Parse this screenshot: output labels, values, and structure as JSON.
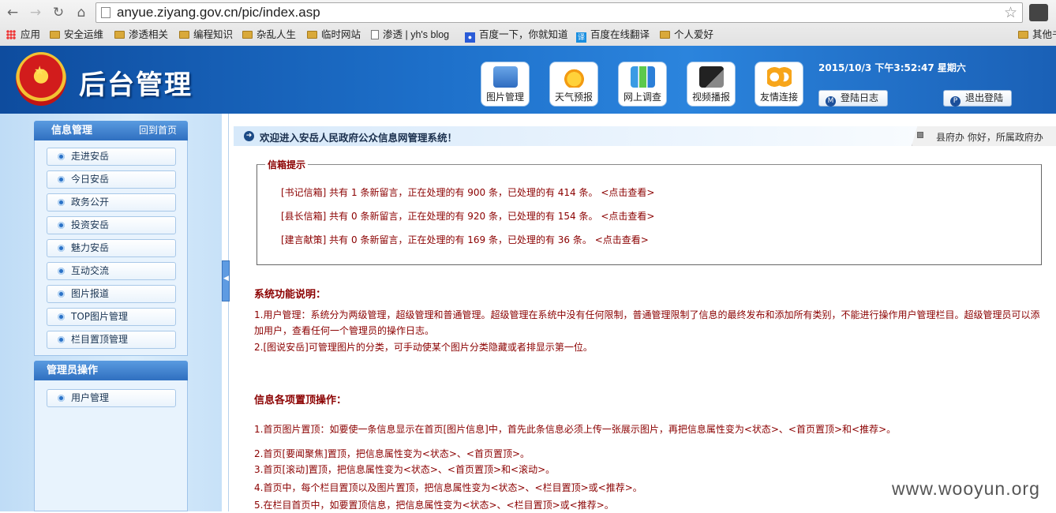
{
  "browser": {
    "url": "anyue.ziyang.gov.cn/pic/index.asp",
    "bookmarks": [
      "应用",
      "安全运维",
      "渗透相关",
      "编程知识",
      "杂乱人生",
      "临时网站",
      "渗透 | yh's blog",
      "百度一下，你就知道",
      "百度在线翻译",
      "个人爱好",
      "其他书签"
    ]
  },
  "header": {
    "title": "后台管理",
    "tools": [
      "图片管理",
      "天气预报",
      "网上调查",
      "视频播报",
      "友情连接"
    ],
    "datetime": "2015/10/3 下午3:52:47 星期六",
    "login_log": "登陆日志",
    "logout": "退出登陆"
  },
  "sidebar": {
    "section1": {
      "title": "信息管理",
      "link": "回到首页"
    },
    "items": [
      "走进安岳",
      "今日安岳",
      "政务公开",
      "投资安岳",
      "魅力安岳",
      "互动交流",
      "图片报道",
      "TOP图片管理",
      "栏目置顶管理"
    ],
    "section2": {
      "title": "管理员操作"
    },
    "admin_items": [
      "用户管理"
    ]
  },
  "main": {
    "welcome": "欢迎进入安岳人民政府公众信息网管理系统！",
    "user_info": "县府办 你好，所属政府办",
    "mailbox": {
      "legend": "信箱提示",
      "rows": [
        "[书记信箱] 共有 1 条新留言，正在处理的有 900 条，已处理的有 414 条。 <点击查看>",
        "[县长信箱] 共有 0 条新留言，正在处理的有 920 条，已处理的有 154 条。 <点击查看>",
        "[建言献策] 共有 0 条新留言，正在处理的有 169 条，已处理的有 36 条。 <点击查看>"
      ]
    },
    "sys_title": "系统功能说明：",
    "sys_1": "1.用户管理：系统分为两级管理，超级管理和普通管理。超级管理在系统中没有任何限制，普通管理限制了信息的最终发布和添加所有类别，不能进行操作用户管理栏目。超级管理员可以添加用户，查看任何一个管理员的操作日志。",
    "sys_2": "2.[图说安岳]可管理图片的分类，可手动使某个图片分类隐藏或者排显示第一位。",
    "top_title": "信息各项置顶操作：",
    "top_1": "1.首页图片置顶：如要使一条信息显示在首页[图片信息]中，首先此条信息必须上传一张展示图片，再把信息属性变为<状态>、<首页置顶>和<推荐>。",
    "top_2": "2.首页[要闻聚焦]置顶，把信息属性变为<状态>、<首页置顶>。",
    "top_3": "3.首页[滚动]置顶，把信息属性变为<状态>、<首页置顶>和<滚动>。",
    "top_4": "4.首页中，每个栏目置顶以及图片置顶，把信息属性变为<状态>、<栏目置顶>或<推荐>。",
    "top_5": "5.在栏目首页中，如要置顶信息，把信息属性变为<状态>、<栏目置顶>或<推荐>。"
  },
  "watermark": "www.wooyun.org"
}
